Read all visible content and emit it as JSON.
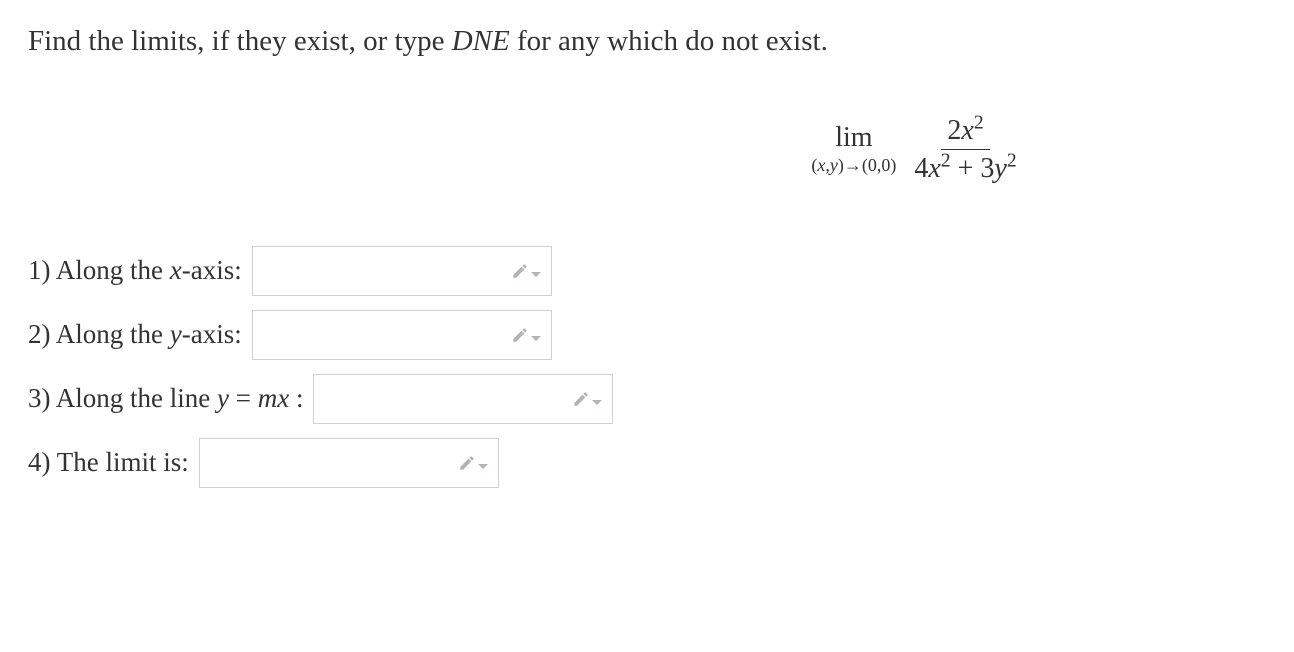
{
  "instruction": {
    "prefix": "Find the limits, if they exist, or type ",
    "dne": "DNE",
    "suffix": " for any which do not exist."
  },
  "limit": {
    "lim_word": "lim",
    "lim_sub_left": "(",
    "lim_sub_x": "x",
    "lim_sub_comma": ",",
    "lim_sub_y": "y",
    "lim_sub_arrow": ")→(0,0)",
    "numerator_coef": "2",
    "numerator_var": "x",
    "numerator_exp": "2",
    "denom_term1_coef": "4",
    "denom_term1_var": "x",
    "denom_term1_exp": "2",
    "denom_plus": " + ",
    "denom_term2_coef": "3",
    "denom_term2_var": "y",
    "denom_term2_exp": "2"
  },
  "questions": {
    "q1_prefix": "1) Along the ",
    "q1_var": "x",
    "q1_suffix": "-axis:",
    "q2_prefix": "2) Along the ",
    "q2_var": "y",
    "q2_suffix": "-axis:",
    "q3_prefix": "3) Along the line ",
    "q3_var1": "y",
    "q3_eq": " = ",
    "q3_var2": "mx",
    "q3_suffix": " :",
    "q4_label": "4) The limit is:"
  }
}
